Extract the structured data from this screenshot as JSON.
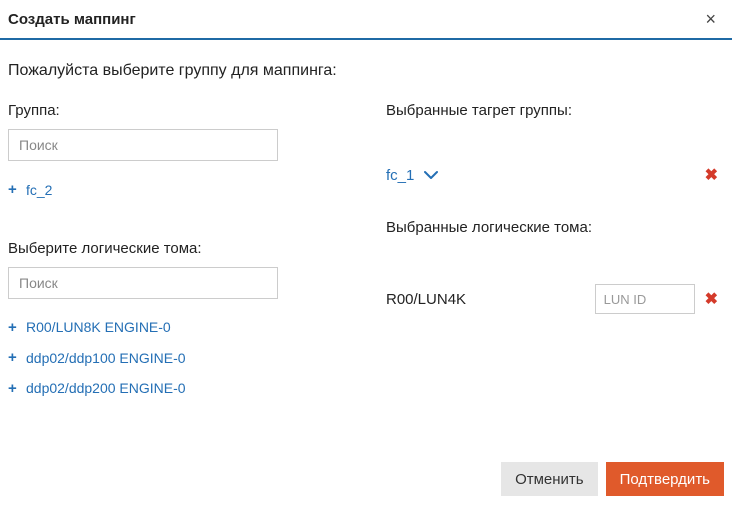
{
  "header": {
    "title": "Создать маппинг",
    "close_label": "×"
  },
  "prompt": "Пожалуйста выберите группу для маппинга:",
  "left": {
    "group": {
      "label": "Группа:",
      "search_placeholder": "Поиск",
      "items": [
        {
          "label": "fc_2"
        }
      ]
    },
    "luns": {
      "label": "Выберите логические тома:",
      "search_placeholder": "Поиск",
      "items": [
        {
          "label": "R00/LUN8K ENGINE-0"
        },
        {
          "label": "ddp02/ddp100 ENGINE-0"
        },
        {
          "label": "ddp02/ddp200 ENGINE-0"
        }
      ]
    }
  },
  "right": {
    "groups": {
      "label": "Выбранные тагрет группы:",
      "items": [
        {
          "label": "fc_1"
        }
      ]
    },
    "luns": {
      "label": "Выбранные логические тома:",
      "items": [
        {
          "label": "R00/LUN4K",
          "lun_id_placeholder": "LUN ID"
        }
      ]
    }
  },
  "footer": {
    "cancel": "Отменить",
    "confirm": "Подтвердить"
  },
  "icons": {
    "plus": "+",
    "remove": "✖"
  }
}
